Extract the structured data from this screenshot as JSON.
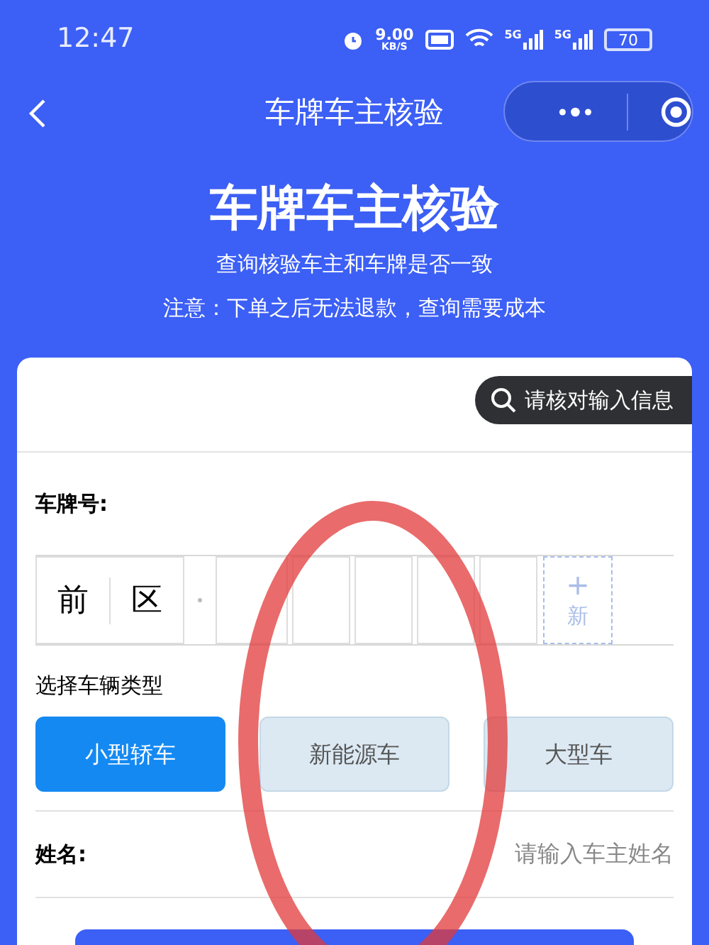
{
  "status_bar": {
    "time": "12:47",
    "speed": "9.00",
    "speed_unit": "KB/S",
    "signals": [
      "5G",
      "5G"
    ],
    "battery": "70"
  },
  "nav": {
    "title": "车牌车主核验"
  },
  "header": {
    "title": "车牌车主核验",
    "subtitle": "查询核验车主和车牌是否一致",
    "notice": "注意：下单之后无法退款，查询需要成本"
  },
  "hint": {
    "text": "请核对输入信息"
  },
  "plate": {
    "label": "车牌号:",
    "chars": [
      "前",
      "区"
    ],
    "new_slot": {
      "plus": "+",
      "label": "新"
    }
  },
  "vehicle_type": {
    "label": "选择车辆类型",
    "options": [
      {
        "label": "小型轿车",
        "selected": true
      },
      {
        "label": "新能源车",
        "selected": false
      },
      {
        "label": "大型车",
        "selected": false
      }
    ]
  },
  "name_field": {
    "label": "姓名:",
    "placeholder": "请输入车主姓名"
  }
}
